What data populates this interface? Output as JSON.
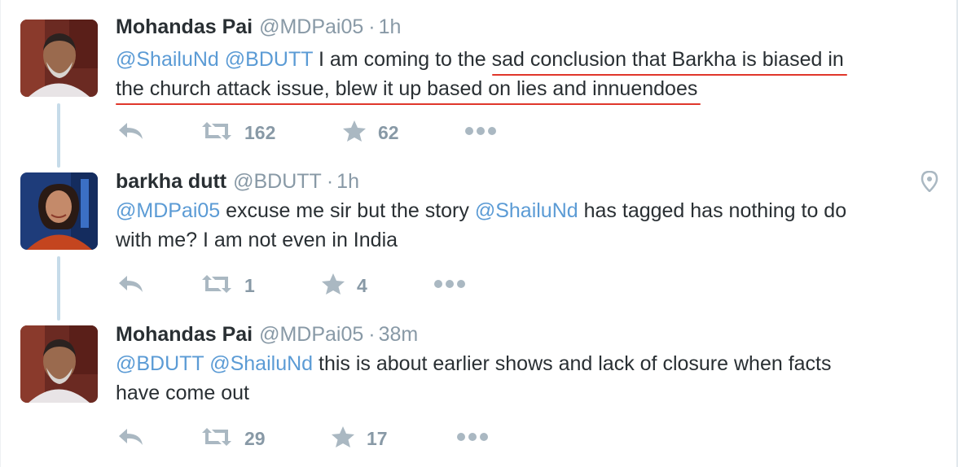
{
  "colors": {
    "mention": "#5b9bd5",
    "underline": "#e0372b",
    "meta": "#8899a6",
    "text": "#292f33",
    "thread": "#c6dbe9"
  },
  "tweets": [
    {
      "name": "Mohandas Pai",
      "handle": "@MDPai05",
      "separator": "·",
      "time": "1h",
      "mentions": [
        "@ShailuNd",
        "@BDUTT"
      ],
      "text_line1_a": " I am coming to the ",
      "text_line1_hl": "sad conclusion that Barkha is biased in",
      "text_line2_hl": "the church attack issue, blew it up based on lies and innuendoes",
      "retweets": "162",
      "favorites": "62"
    },
    {
      "name": "barkha dutt",
      "handle": "@BDUTT",
      "separator": "·",
      "time": "1h",
      "mentions": [
        "@MDPai05",
        "@ShailuNd"
      ],
      "text_line1_a": " excuse me sir but the story ",
      "text_line1_b": " has tagged has nothing to do",
      "text_line2": "with me? I am not even in India",
      "retweets": "1",
      "favorites": "4",
      "location_icon": "map-pin-icon"
    },
    {
      "name": "Mohandas Pai",
      "handle": "@MDPai05",
      "separator": "·",
      "time": "38m",
      "mentions": [
        "@BDUTT",
        "@ShailuNd"
      ],
      "text_line1_a": " this is about earlier shows and lack of closure when facts",
      "text_line2": "have come out",
      "retweets": "29",
      "favorites": "17"
    }
  ],
  "icons": [
    "reply-icon",
    "retweet-icon",
    "star-icon",
    "more-icon"
  ]
}
